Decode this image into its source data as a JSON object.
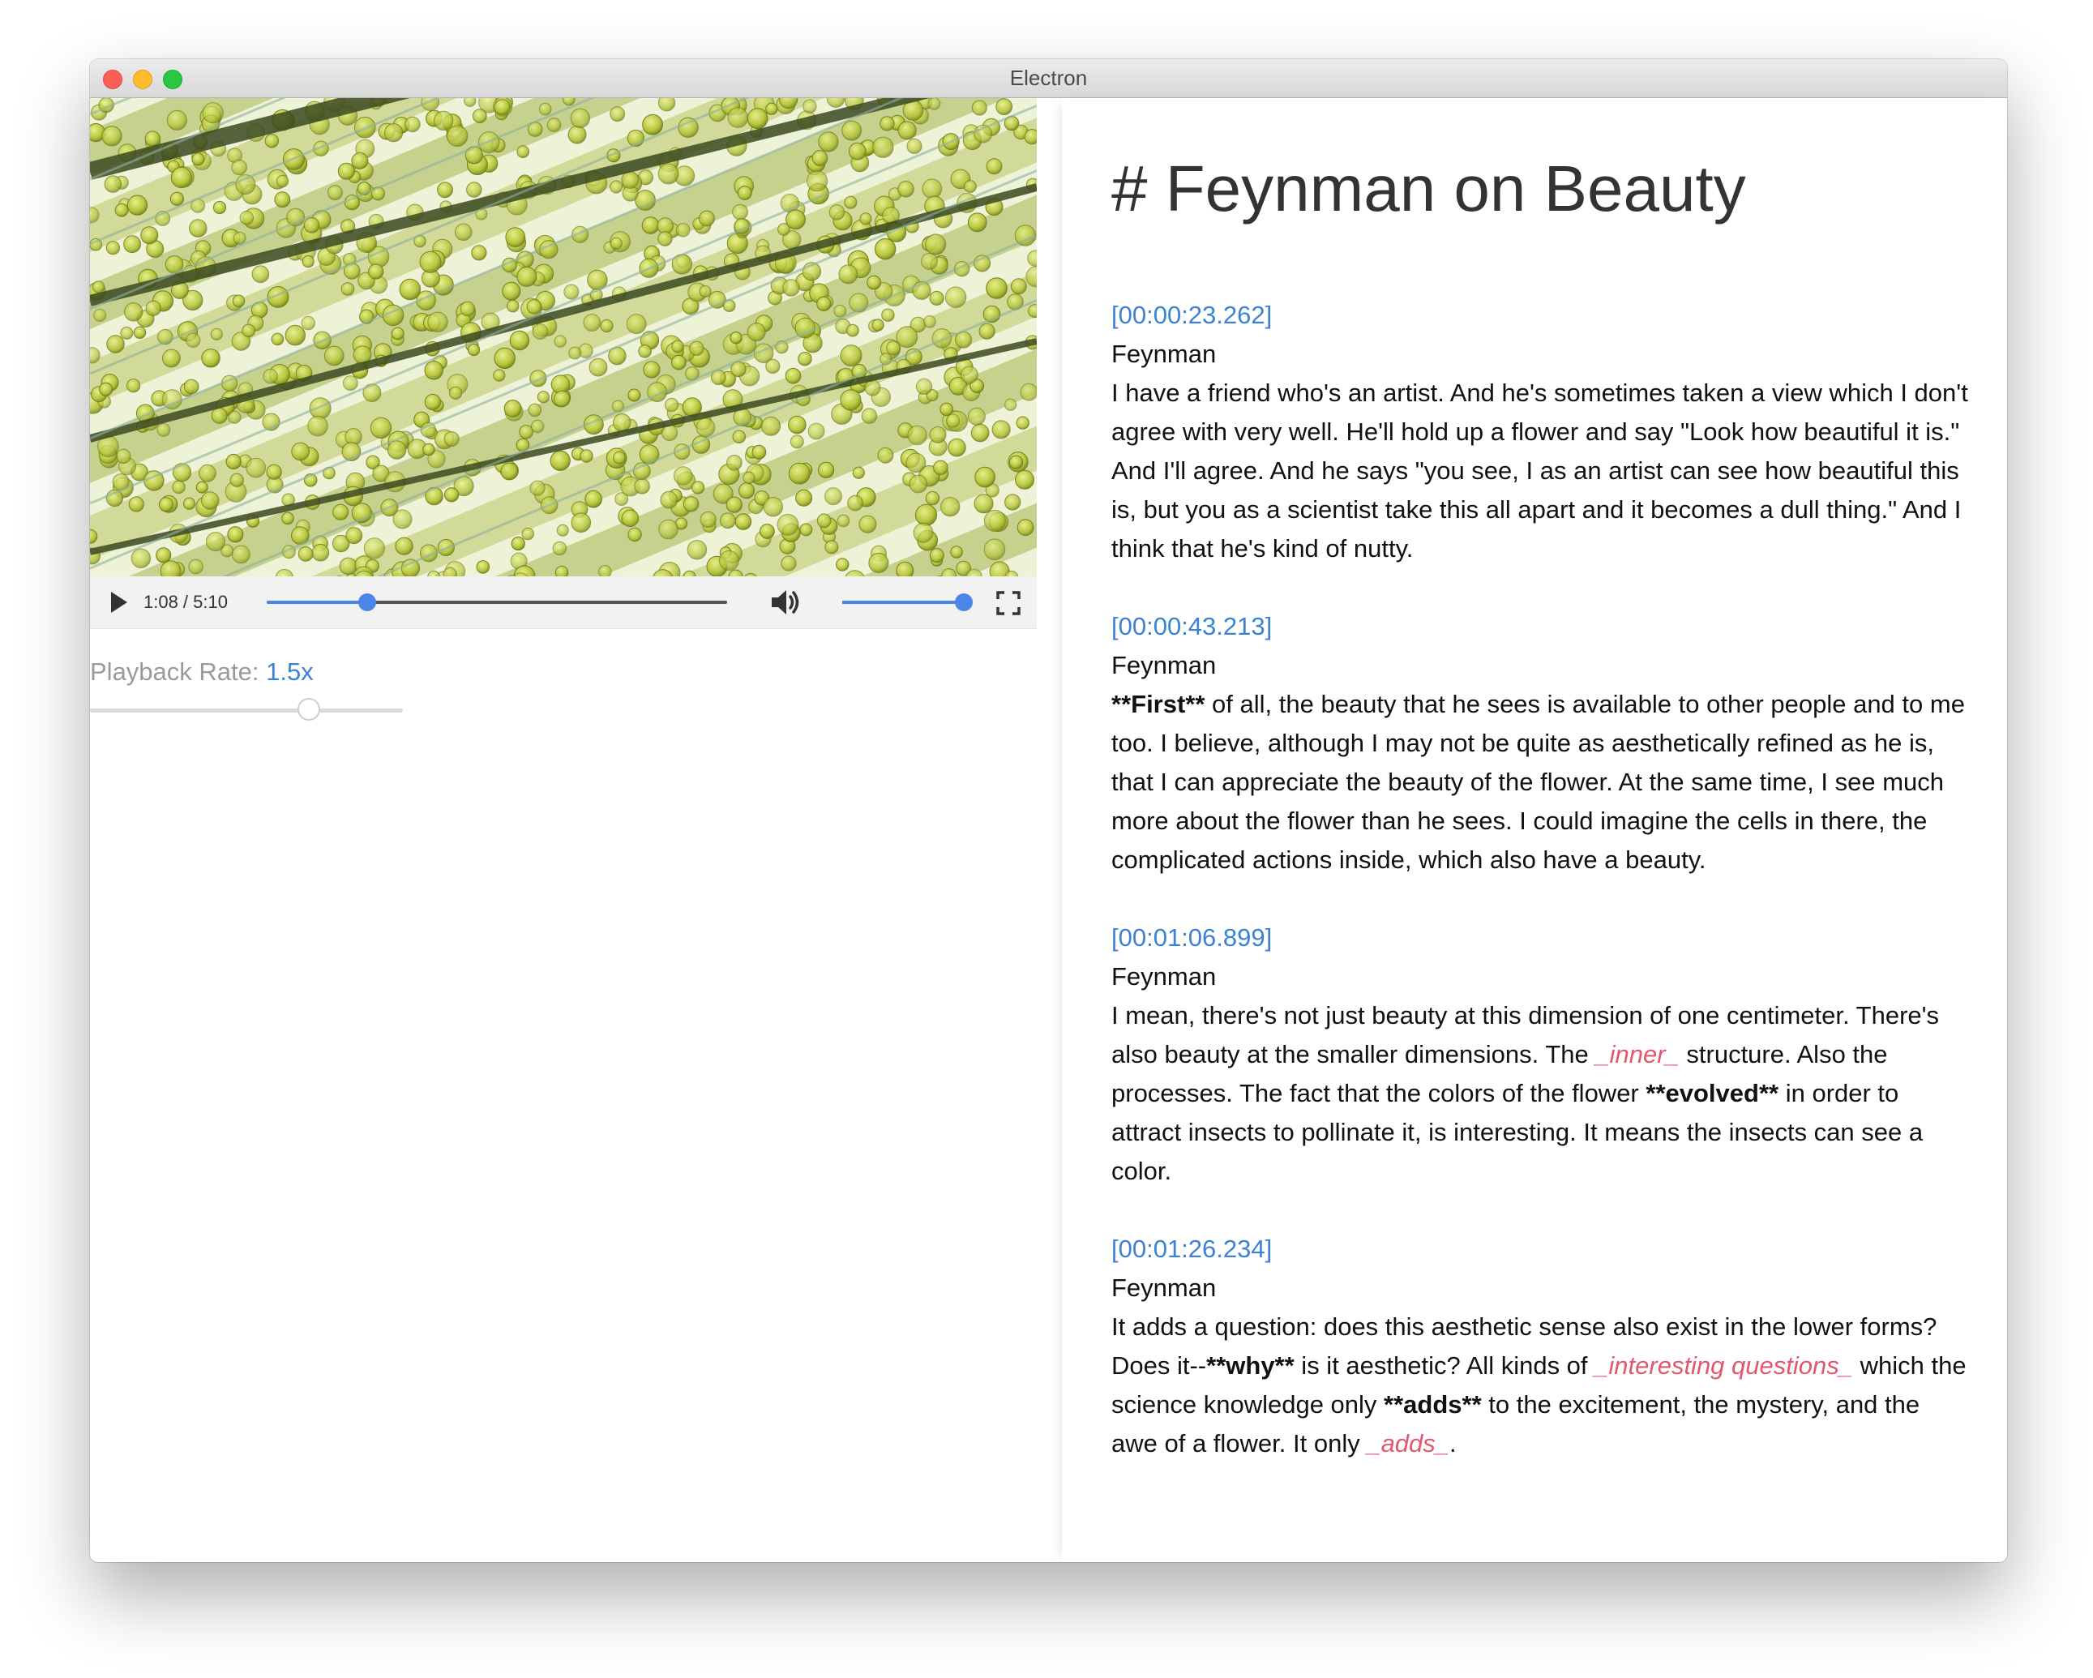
{
  "window": {
    "title": "Electron"
  },
  "video": {
    "current_time": "1:08",
    "duration": "5:10",
    "time_display": "1:08 / 5:10",
    "progress_fraction": 0.219,
    "volume_fraction": 1.0,
    "icons": {
      "play": "play-icon",
      "volume": "speaker-icon",
      "fullscreen": "fullscreen-icon"
    },
    "accent_color": "#4a86e8"
  },
  "playback": {
    "label": "Playback Rate:",
    "value": "1.5x",
    "slider_fraction": 0.7
  },
  "transcript": {
    "title": "# Feynman on Beauty",
    "timestamp_color": "#3b82d6",
    "emphasis_color": "#e2566e",
    "entries": [
      {
        "timestamp": "[00:00:23.262]",
        "speaker": "Feynman",
        "segments": [
          {
            "t": "I have a friend who's an artist. And he's sometimes taken a view which I don't agree with very well. He'll hold up a flower and say \"Look how beautiful it is.\" And I'll agree. And he says \"you see, I as an artist can see how beautiful this is, but you as a scientist take this all apart and it becomes a dull thing.\" And I think that he's kind of nutty."
          }
        ]
      },
      {
        "timestamp": "[00:00:43.213]",
        "speaker": "Feynman",
        "segments": [
          {
            "t": "**First**",
            "s": "bold"
          },
          {
            "t": " of all, the beauty that he sees is available to other people and to me too. I believe, although I may not be quite as aesthetically refined as he is, that I can appreciate the beauty of the flower. At the same time, I see much more about the flower than he sees. I could imagine the cells in there, the complicated actions inside, which also have a beauty."
          }
        ]
      },
      {
        "timestamp": "[00:01:06.899]",
        "speaker": "Feynman",
        "segments": [
          {
            "t": "I mean, there's not just beauty at this dimension of one centimeter. There's also beauty at the smaller dimensions. The "
          },
          {
            "t": "_inner_",
            "s": "em"
          },
          {
            "t": " structure. Also the processes. The fact that the colors of the flower "
          },
          {
            "t": "**evolved**",
            "s": "bold"
          },
          {
            "t": " in order to attract insects to pollinate it, is interesting. It means the insects can see a color."
          }
        ]
      },
      {
        "timestamp": "[00:01:26.234]",
        "speaker": "Feynman",
        "segments": [
          {
            "t": "It adds a question: does this aesthetic sense also exist in the lower forms? Does it--"
          },
          {
            "t": "**why**",
            "s": "bold"
          },
          {
            "t": " is it aesthetic? All kinds of "
          },
          {
            "t": "_interesting questions_",
            "s": "em"
          },
          {
            "t": " which the science knowledge only "
          },
          {
            "t": "**adds**",
            "s": "bold"
          },
          {
            "t": " to the excitement, the mystery, and the awe of a flower. It only "
          },
          {
            "t": "_adds_",
            "s": "em"
          },
          {
            "t": "."
          }
        ]
      }
    ]
  }
}
